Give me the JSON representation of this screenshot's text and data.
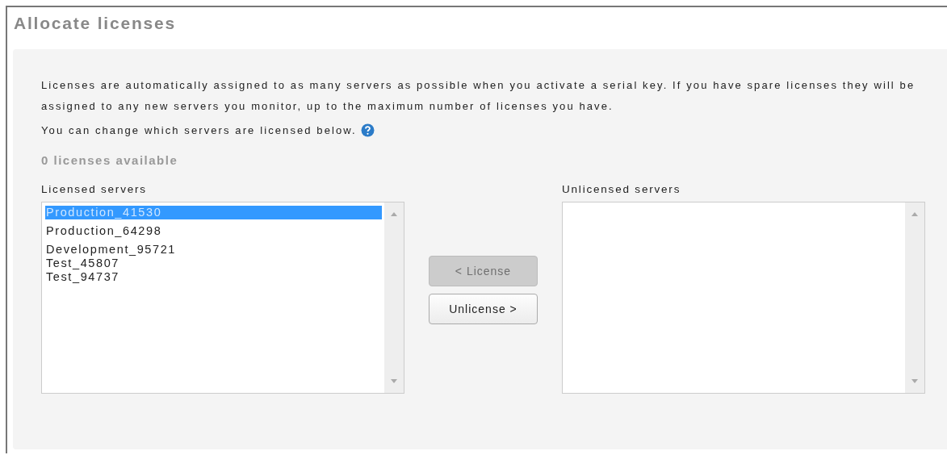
{
  "title": "Allocate licenses",
  "intro_lines": [
    "Licenses are automatically assigned to as many servers as possible when you activate a serial key. If you have spare licenses they will be",
    "assigned to any new servers you monitor, up to the maximum number of licenses you have."
  ],
  "change_note": "You can change which servers are licensed below.",
  "available": "0 licenses available",
  "licensed": {
    "label": "Licensed servers",
    "items": [
      {
        "name": "Production_41530",
        "selected": true
      },
      {
        "name": "Production_64298",
        "selected": false
      },
      {
        "name": "Development_95721",
        "selected": false
      },
      {
        "name": "Test_45807",
        "selected": false
      },
      {
        "name": "Test_94737",
        "selected": false
      }
    ]
  },
  "buttons": [
    {
      "label": "< License",
      "disabled": true
    },
    {
      "label": "Unlicense >",
      "disabled": false
    }
  ],
  "unlicensed": {
    "label": "Unlicensed servers"
  }
}
